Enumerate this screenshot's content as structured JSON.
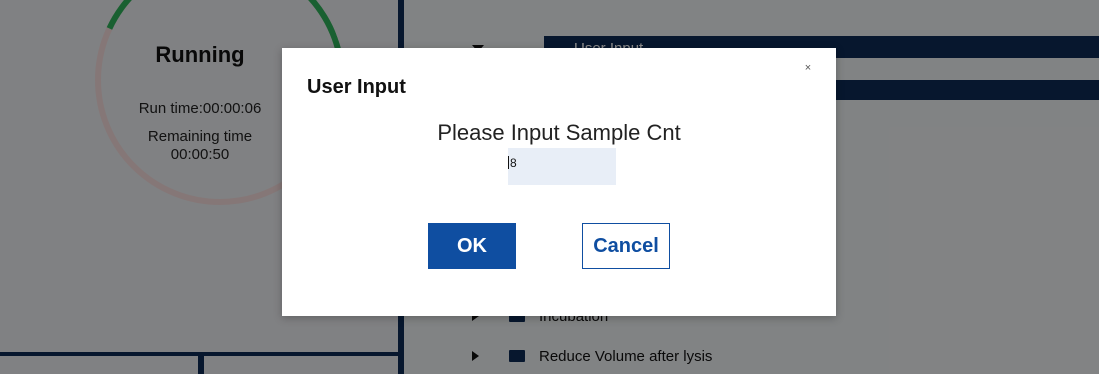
{
  "app": {
    "status": {
      "title": "Running",
      "run_time": "Run time:00:00:06",
      "remaining_label": "Remaining time",
      "remaining_value": "00:00:50"
    },
    "tree": {
      "items": [
        {
          "label": "User Input",
          "expanded": true,
          "selected": true
        },
        {
          "label": "Incubation",
          "expanded": false,
          "selected": false
        },
        {
          "label": "Reduce Volume after lysis",
          "expanded": false,
          "selected": false
        }
      ]
    }
  },
  "dialog": {
    "title": "User Input",
    "close_label": "×",
    "prompt": "Please Input Sample Cnt",
    "input_value": "8",
    "ok_label": "OK",
    "cancel_label": "Cancel"
  },
  "colors": {
    "navy": "#0d2a55",
    "primary_button": "#0f4ea1",
    "input_background": "#e8eef7",
    "progress_green": "#2fb05a"
  },
  "icons": {
    "tree_expand_collapsed": "triangle-right-icon",
    "tree_expand_expanded": "triangle-down-icon",
    "tree_folder": "folder-icon",
    "close": "close-icon"
  }
}
